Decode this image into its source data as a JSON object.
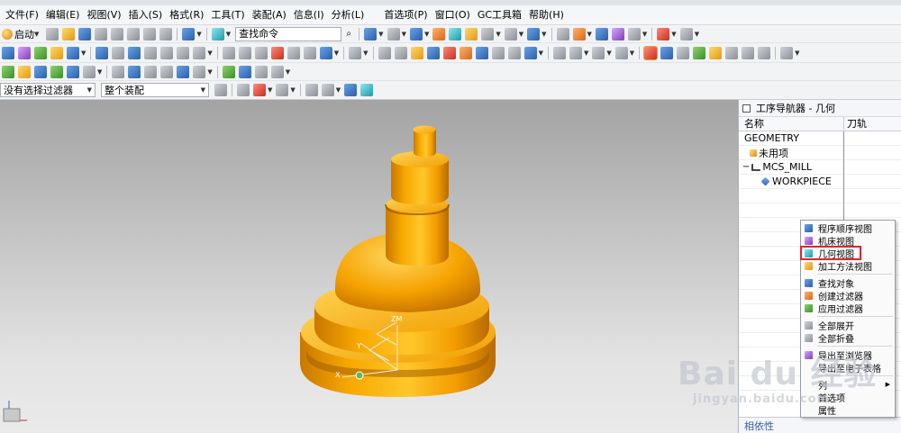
{
  "menubar": {
    "items": [
      "文件(F)",
      "编辑(E)",
      "视图(V)",
      "插入(S)",
      "格式(R)",
      "工具(T)",
      "装配(A)",
      "信息(I)",
      "分析(L)",
      "首选项(P)",
      "窗口(O)",
      "GC工具箱",
      "帮助(H)"
    ]
  },
  "toolbar": {
    "start_label": "启动",
    "search_value": "查找命令",
    "search_icon_glyph": "⌕"
  },
  "filter_bar": {
    "selection_filter": "没有选择过滤器",
    "assembly_scope": "整个装配"
  },
  "navigator": {
    "title": "工序导航器 - 几何",
    "col_name": "名称",
    "col_tool": "刀轨",
    "nodes": {
      "geometry": "GEOMETRY",
      "unused": "未用项",
      "mcs": "MCS_MILL",
      "workpiece": "WORKPIECE"
    },
    "related_label": "相依性"
  },
  "context_menu": {
    "items": [
      "程序顺序视图",
      "机床视图",
      "几何视图",
      "加工方法视图",
      "查找对象",
      "创建过滤器",
      "应用过滤器",
      "全部展开",
      "全部折叠",
      "导出至浏览器",
      "导出至电子表格",
      "列",
      "首选项",
      "属性"
    ]
  },
  "viewport": {
    "axis_zm": "ZM",
    "axis_x": "X",
    "axis_y": "Y"
  },
  "watermark": {
    "brand": "Bai du 经验",
    "url": "jingyan.baidu.com"
  },
  "colors": {
    "part_orange": "#f5a400",
    "part_dark": "#b26b00",
    "highlight_red": "#e3262a"
  }
}
